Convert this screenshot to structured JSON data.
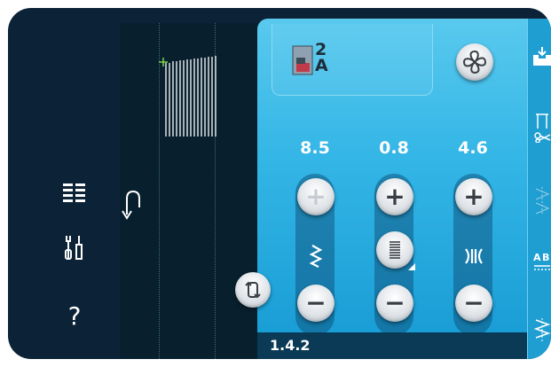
{
  "left_menu": {
    "icons": [
      "selection-menu-icon",
      "tools-icon",
      "help-icon"
    ],
    "help_label": "?"
  },
  "stitch_area": {
    "icon": "reverse-direction-icon"
  },
  "top": {
    "presser_foot": {
      "line1": "2",
      "line2": "A"
    },
    "fan_icon": "fan-icon"
  },
  "controls": [
    {
      "id": "stitch-width",
      "value": "8.5",
      "icon": "stitch-width-icon",
      "plus_label": "+",
      "minus_label": "−",
      "plus_disabled": true
    },
    {
      "id": "stitch-density",
      "value": "0.8",
      "icon": "stitch-density-icon",
      "plus_label": "+",
      "minus_label": "−",
      "plus_disabled": false
    },
    {
      "id": "stitch-positioning",
      "value": "4.6",
      "icon": "stitch-positioning-icon",
      "plus_label": "+",
      "minus_label": "−",
      "plus_disabled": false
    }
  ],
  "footer": {
    "stitch_number": "1.4.2"
  },
  "right_bar": {
    "icons": [
      "load-icon",
      "thread-cutter-icon",
      "mirror-icon",
      "sequence-icon",
      "stitch-program-icon"
    ],
    "ab_label": "A B"
  },
  "colors": {
    "device_bg": "#0c2237",
    "panel_top": "#59c9ee",
    "panel_bottom": "#169ad3",
    "stitch_bg": "#08202e",
    "accent_green": "#7ad44a"
  }
}
